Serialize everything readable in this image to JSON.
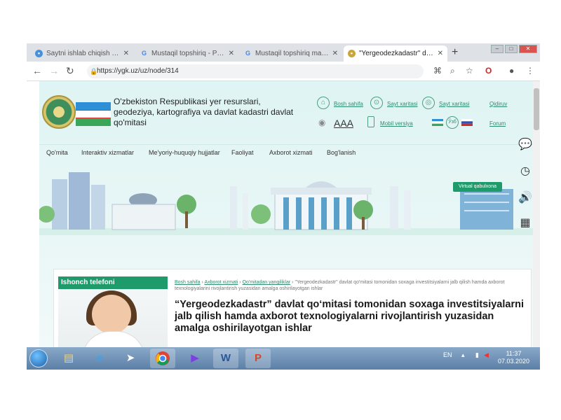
{
  "browser": {
    "tabs": [
      {
        "title": "Saytni ishlab chiqish …",
        "active": false
      },
      {
        "title": "Mustaqil topshiriq - Pu…",
        "active": false
      },
      {
        "title": "Mustaqil topshiriq mavz…",
        "active": false
      },
      {
        "title": "\"Yergeodezkadastr\" davlat …",
        "active": true
      }
    ],
    "new_tab": "+",
    "url": "https://ygk.uz/uz/node/314"
  },
  "site": {
    "org_title": "O'zbekiston Respublikasi yer resurslari, geodeziya, kartografiya va davlat kadastri davlat qo'mitasi",
    "header_links": {
      "home": "Bosh sahifa",
      "sitemap": "Sayt xaritasi",
      "map": "Sayt xaritasi",
      "login": "Qidiruv",
      "font_size": "AAA",
      "mobile": "Mobil versiya",
      "lang": "Ўзб",
      "poll": "Forum"
    },
    "nav": [
      "Qo'mita",
      "Interaktiv xizmatlar",
      "Me'yoriy-huquqiy hujjatlar",
      "Faoliyat",
      "Axborot xizmati",
      "Bog'lanish"
    ],
    "virtual_button": "Virtual qabulxona",
    "hotline": "Ishonch telefoni",
    "breadcrumb": {
      "home": "Bosh sahifa",
      "sep": "›",
      "info": "Axborot xizmati",
      "news": "Qo'mitadan yangiliklar",
      "rest": "\"Yergeodezkadastr\" davlat qo'mitasi tomonidan soxaga investitsiyalarni jalb qilish hamda axborot texnologiyalarini rivojlantirish yuzasidan amalga oshirilayotgan ishlar"
    },
    "article_title": "“Yergeodezkadastr” davlat qo‘mitasi tomonidan soxaga investitsiyalarni jalb qilish hamda axborot texnologiyalarni rivojlantirish yuzasidan amalga oshirilayotgan ishlar"
  },
  "taskbar": {
    "lang": "EN",
    "time": "11:37",
    "date": "07.03.2020"
  },
  "colors": {
    "accent": "#1f9a6a",
    "banner": "#dff4f4",
    "taskbar": "#5b7fa6"
  }
}
